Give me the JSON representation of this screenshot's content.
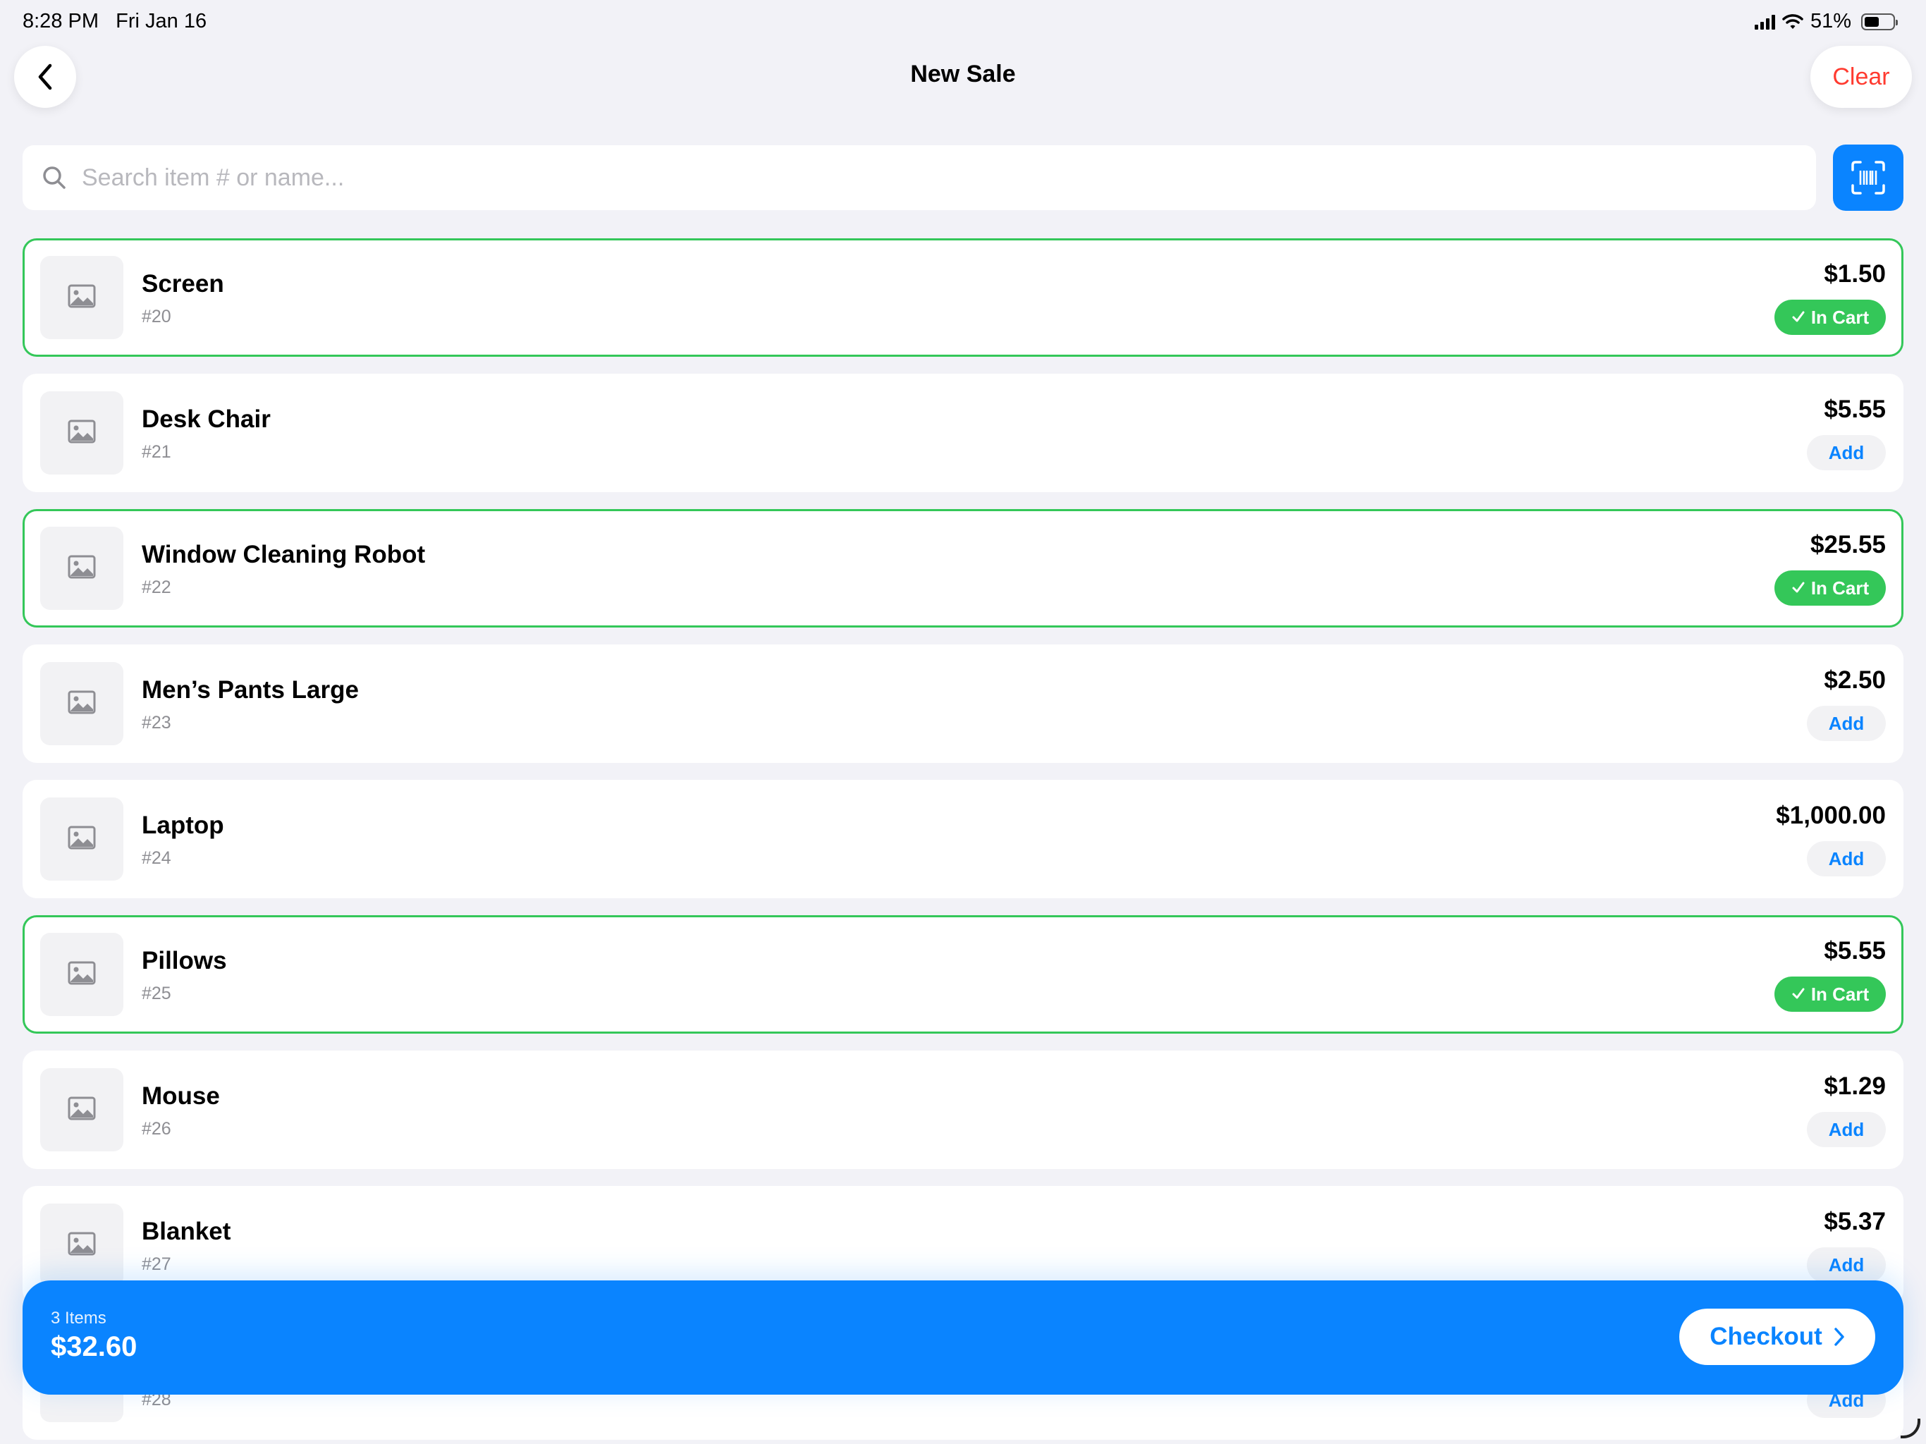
{
  "status_bar": {
    "time": "8:28 PM",
    "date": "Fri Jan 16",
    "battery": "51%"
  },
  "header": {
    "title": "New Sale",
    "clear_label": "Clear"
  },
  "search": {
    "placeholder": "Search item # or name..."
  },
  "items": [
    {
      "name": "Screen",
      "number": "#20",
      "price": "$1.50",
      "in_cart": true
    },
    {
      "name": "Desk Chair",
      "number": "#21",
      "price": "$5.55",
      "in_cart": false
    },
    {
      "name": "Window Cleaning Robot",
      "number": "#22",
      "price": "$25.55",
      "in_cart": true
    },
    {
      "name": "Men’s Pants Large",
      "number": "#23",
      "price": "$2.50",
      "in_cart": false
    },
    {
      "name": "Laptop",
      "number": "#24",
      "price": "$1,000.00",
      "in_cart": false
    },
    {
      "name": "Pillows",
      "number": "#25",
      "price": "$5.55",
      "in_cart": true
    },
    {
      "name": "Mouse",
      "number": "#26",
      "price": "$1.29",
      "in_cart": false
    },
    {
      "name": "Blanket",
      "number": "#27",
      "price": "$5.37",
      "in_cart": false
    },
    {
      "name": "",
      "number": "#28",
      "price": "",
      "in_cart": false
    }
  ],
  "labels": {
    "in_cart": "In Cart",
    "add": "Add"
  },
  "cart": {
    "count_label": "3 Items",
    "total": "$32.60",
    "checkout_label": "Checkout"
  },
  "colors": {
    "accent": "#0a84ff",
    "in_cart": "#34c759",
    "destructive": "#ff3b30",
    "background": "#f2f2f7"
  }
}
